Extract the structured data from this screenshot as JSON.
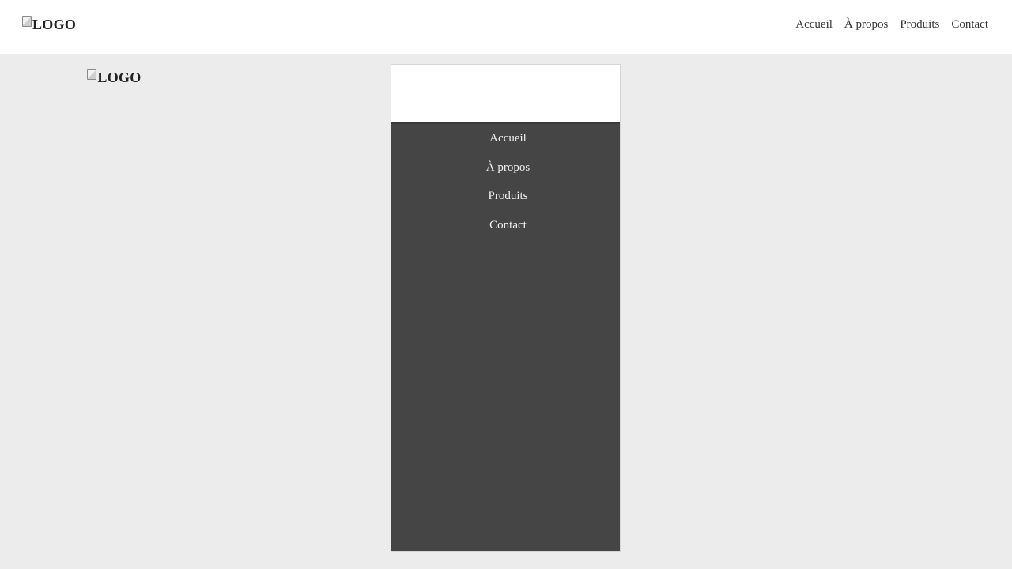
{
  "header": {
    "logo_alt": "LOGO",
    "nav": [
      "Accueil",
      "À propos",
      "Produits",
      "Contact"
    ]
  },
  "mobile_preview": {
    "logo_alt": "LOGO",
    "nav": [
      "Accueil",
      "À propos",
      "Produits",
      "Contact"
    ]
  },
  "colors": {
    "page_background": "#ececec",
    "header_background": "#ffffff",
    "mobile_menu_background": "#454545",
    "mobile_menu_text": "#f1f1f1",
    "top_nav_text": "#333333"
  },
  "icons": {
    "logo_image": "broken-image-icon"
  }
}
